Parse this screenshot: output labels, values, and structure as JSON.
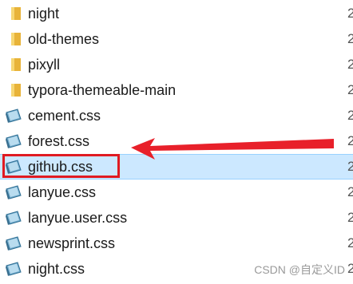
{
  "files": [
    {
      "name": "night",
      "type": "folder",
      "icon": "folder-icon",
      "col2": "2"
    },
    {
      "name": "old-themes",
      "type": "folder",
      "icon": "folder-icon",
      "col2": "2"
    },
    {
      "name": "pixyll",
      "type": "folder",
      "icon": "folder-icon",
      "col2": "2"
    },
    {
      "name": "typora-themeable-main",
      "type": "folder",
      "icon": "folder-icon",
      "col2": "2"
    },
    {
      "name": "cement.css",
      "type": "file",
      "icon": "css-file-icon",
      "col2": "2"
    },
    {
      "name": "forest.css",
      "type": "file",
      "icon": "css-file-icon",
      "col2": "2"
    },
    {
      "name": "github.css",
      "type": "file",
      "icon": "css-file-icon",
      "col2": "2",
      "selected": true
    },
    {
      "name": "lanyue.css",
      "type": "file",
      "icon": "css-file-icon",
      "col2": "2"
    },
    {
      "name": "lanyue.user.css",
      "type": "file",
      "icon": "css-file-icon",
      "col2": "2"
    },
    {
      "name": "newsprint.css",
      "type": "file",
      "icon": "css-file-icon",
      "col2": "2"
    },
    {
      "name": "night.css",
      "type": "file",
      "icon": "css-file-icon",
      "col2": "2"
    }
  ],
  "watermark": "CSDN @自定义ID",
  "colors": {
    "selected_bg": "#cce8ff",
    "annotation": "#e01b22",
    "folder": "#f4c542"
  }
}
